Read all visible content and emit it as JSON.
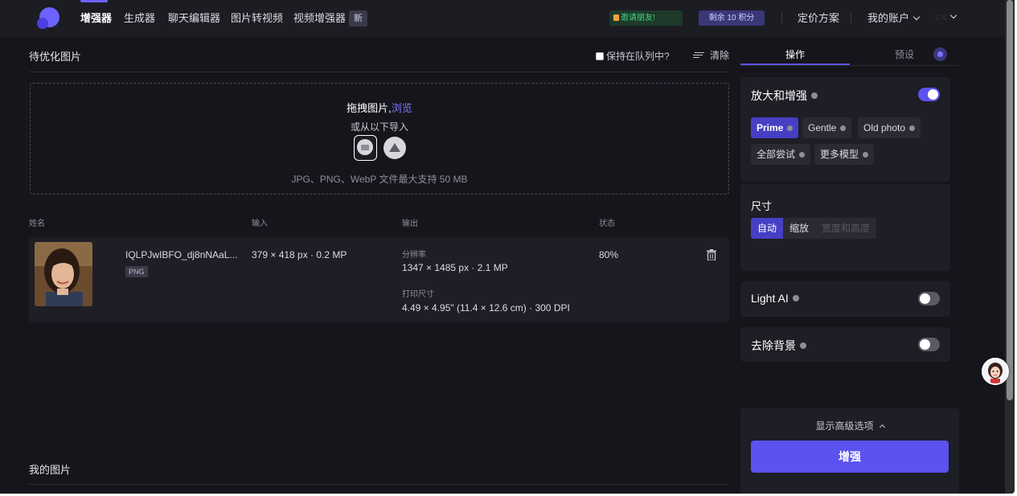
{
  "nav": {
    "items": [
      "增强器",
      "生成器",
      "聊天编辑器",
      "图片转视频",
      "视频增强器"
    ],
    "new_badge": "新",
    "invite": "邀请朋友!",
    "credits": "剩余 10 积分",
    "pricing": "定价方案",
    "account": "我的账户",
    "lang": "CN"
  },
  "left": {
    "queue_title": "待优化图片",
    "keep_in_queue": "保持在队列中?",
    "clear": "清除",
    "dropzone": {
      "drag_text": "拖拽图片,",
      "browse": "浏览",
      "or_import": "或从以下导入",
      "formats": "JPG、PNG、WebP 文件最大支持 50 MB"
    },
    "columns": [
      "姓名",
      "输入",
      "输出",
      "状态"
    ],
    "file": {
      "name": "IQLPJwIBFO_dj8nNAaL...",
      "type": "PNG",
      "input": "379 × 418 px · 0.2 MP",
      "resolution_label": "分辨率",
      "resolution": "1347 × 1485 px · 2.1 MP",
      "print_label": "打印尺寸",
      "print_size": "4.49 × 4.95\" (11.4 × 12.6 cm) · 300 DPI",
      "status": "80%"
    },
    "my_images": "我的图片"
  },
  "right": {
    "tabs": [
      "操作",
      "预设"
    ],
    "upscale": {
      "title": "放大和增强",
      "enabled": true,
      "models": [
        "Prime",
        "Gentle",
        "Old photo",
        "全部尝试",
        "更多模型"
      ],
      "selected": "Prime"
    },
    "size": {
      "title": "尺寸",
      "options": [
        "自动",
        "缩放",
        "宽度和高度"
      ],
      "selected": "自动"
    },
    "light_ai": {
      "title": "Light AI",
      "enabled": false
    },
    "remove_bg": {
      "title": "去除背景",
      "enabled": false
    },
    "advanced": "显示高级选项",
    "enhance_button": "增强"
  },
  "colors": {
    "accent": "#5b52f0",
    "background": "#15151b",
    "panel": "#1e1e26",
    "invite_green": "#43d17e"
  }
}
